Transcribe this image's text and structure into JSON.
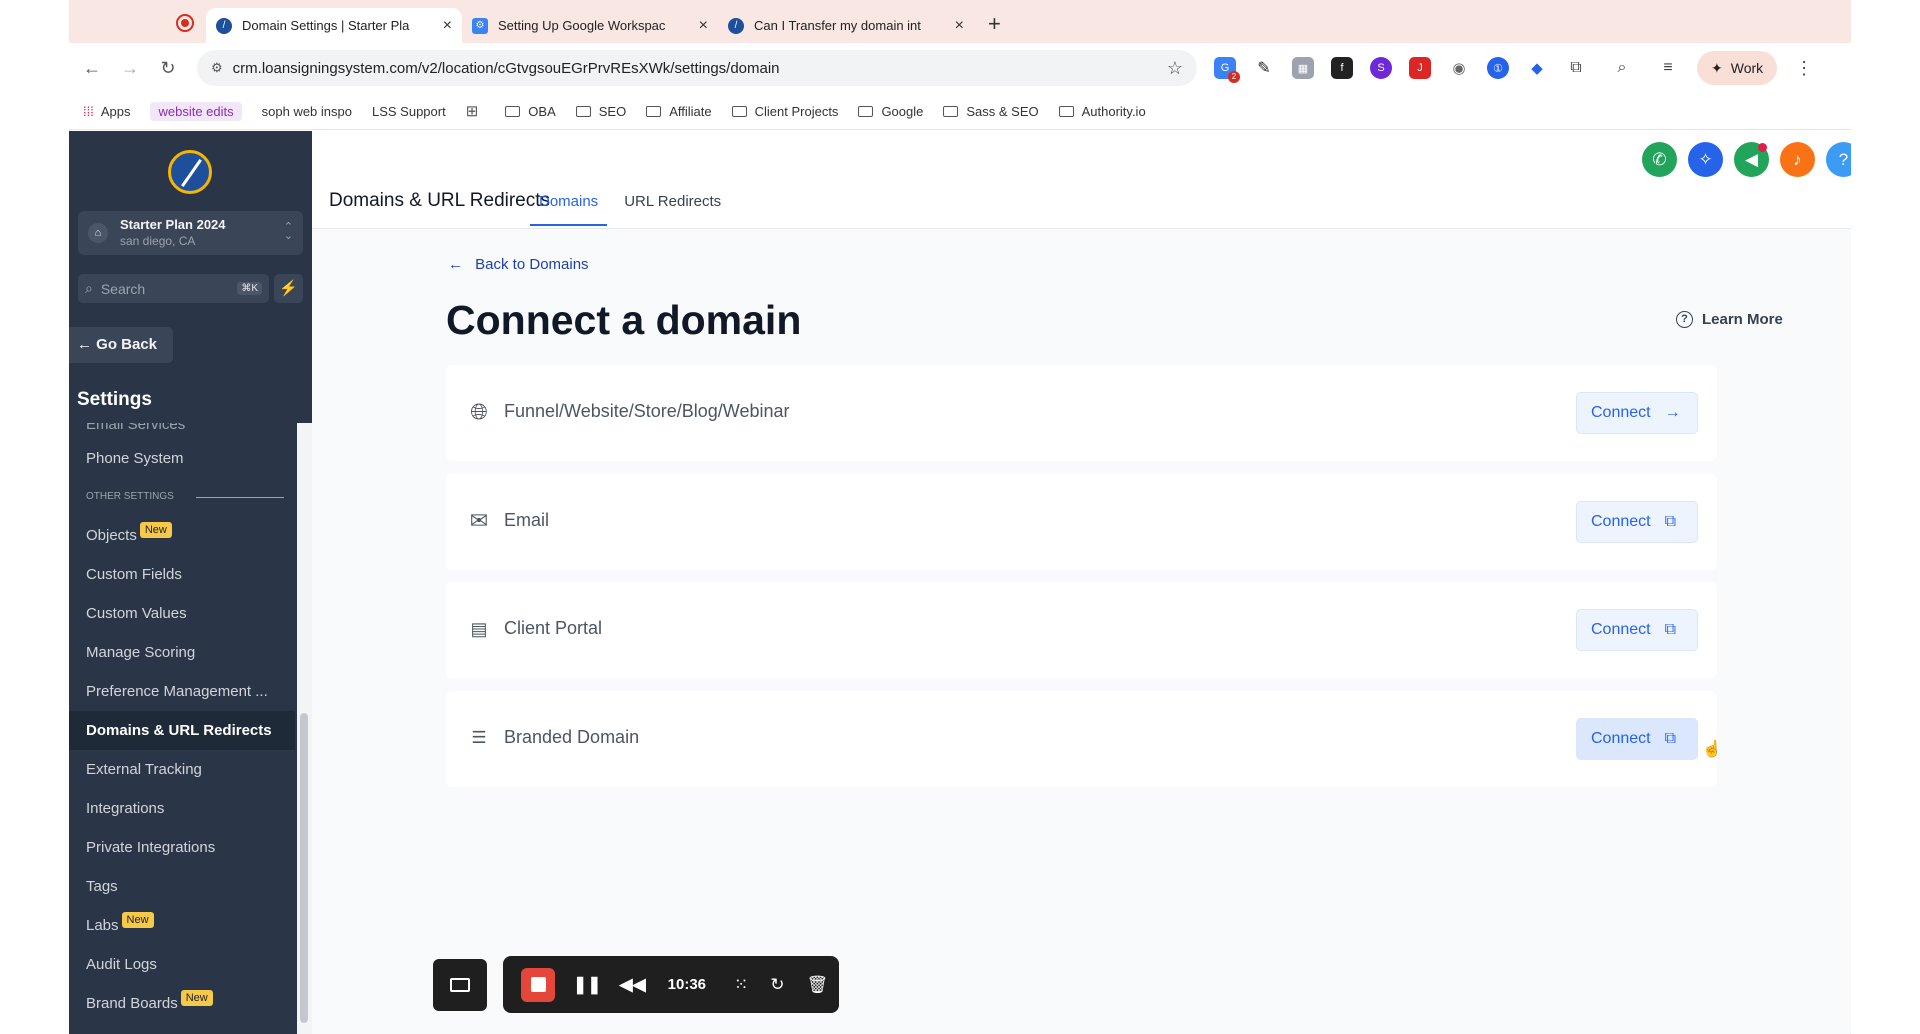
{
  "browser": {
    "tabs": [
      {
        "title": "Domain Settings | Starter Pla",
        "active": true,
        "favicon_color": "#1e4f9c"
      },
      {
        "title": "Setting Up Google Workspac",
        "active": false,
        "favicon_color": "#3b82f6"
      },
      {
        "title": "Can I Transfer my domain int",
        "active": false,
        "favicon_color": "#1e4f9c"
      }
    ],
    "url": "crm.loansigningsystem.com/v2/location/cGtvgsouEGrPrvREsXWk/settings/domain",
    "profile_label": "Work",
    "extension_badge": "2",
    "bookmarks": [
      {
        "label": "Apps",
        "icon": "apps-grid-icon"
      },
      {
        "label": "website edits",
        "icon": "none"
      },
      {
        "label": "soph web inspo",
        "icon": "none"
      },
      {
        "label": "LSS Support",
        "icon": "none"
      },
      {
        "label": "",
        "icon": "grid-icon"
      },
      {
        "label": "OBA",
        "icon": "folder-icon"
      },
      {
        "label": "SEO",
        "icon": "folder-icon"
      },
      {
        "label": "Affiliate",
        "icon": "folder-icon"
      },
      {
        "label": "Client Projects",
        "icon": "folder-icon"
      },
      {
        "label": "Google",
        "icon": "folder-icon"
      },
      {
        "label": "Sass & SEO",
        "icon": "folder-icon"
      },
      {
        "label": "Authority.io",
        "icon": "folder-icon"
      }
    ]
  },
  "sidebar": {
    "location_name": "Starter Plan 2024",
    "location_city": "san diego, CA",
    "search_placeholder": "Search",
    "search_shortcut": "⌘K",
    "go_back": "Go Back",
    "heading": "Settings",
    "clipped_item": "Email Services",
    "items_top": [
      {
        "label": "Phone System",
        "new": false,
        "selected": false
      }
    ],
    "section_label": "OTHER SETTINGS",
    "items": [
      {
        "label": "Objects",
        "new": true,
        "selected": false
      },
      {
        "label": "Custom Fields",
        "new": false,
        "selected": false
      },
      {
        "label": "Custom Values",
        "new": false,
        "selected": false
      },
      {
        "label": "Manage Scoring",
        "new": false,
        "selected": false
      },
      {
        "label": "Preference Management ...",
        "new": false,
        "selected": false
      },
      {
        "label": "Domains & URL Redirects",
        "new": false,
        "selected": true
      },
      {
        "label": "External Tracking",
        "new": false,
        "selected": false
      },
      {
        "label": "Integrations",
        "new": false,
        "selected": false
      },
      {
        "label": "Private Integrations",
        "new": false,
        "selected": false
      },
      {
        "label": "Tags",
        "new": false,
        "selected": false
      },
      {
        "label": "Labs",
        "new": true,
        "selected": false
      },
      {
        "label": "Audit Logs",
        "new": false,
        "selected": false
      },
      {
        "label": "Brand Boards",
        "new": true,
        "selected": false
      }
    ],
    "new_badge": "New"
  },
  "header": {
    "title": "Domains & URL Redirects",
    "tabs": [
      {
        "label": "Domains",
        "active": true
      },
      {
        "label": "URL Redirects",
        "active": false
      }
    ],
    "icons": [
      {
        "name": "phone-icon",
        "color": "#22a55b"
      },
      {
        "name": "magic-wand-icon",
        "color": "#2563eb"
      },
      {
        "name": "megaphone-icon",
        "color": "#22a55b"
      },
      {
        "name": "bell-icon",
        "color": "#f97316"
      },
      {
        "name": "help-icon",
        "color": "#3b9bf5"
      }
    ]
  },
  "content": {
    "back_link": "Back to Domains",
    "title": "Connect a domain",
    "learn_more": "Learn More",
    "cards": [
      {
        "label": "Funnel/Website/Store/Blog/Webinar",
        "icon": "globe-icon",
        "button": "Connect",
        "button_icon": "arrow-right-icon"
      },
      {
        "label": "Email",
        "icon": "mail-icon",
        "button": "Connect",
        "button_icon": "external-link-icon"
      },
      {
        "label": "Client Portal",
        "icon": "portal-icon",
        "button": "Connect",
        "button_icon": "external-link-icon"
      },
      {
        "label": "Branded Domain",
        "icon": "branded-domain-icon",
        "button": "Connect",
        "button_icon": "external-link-icon"
      }
    ]
  },
  "recorder": {
    "time": "10:36"
  }
}
